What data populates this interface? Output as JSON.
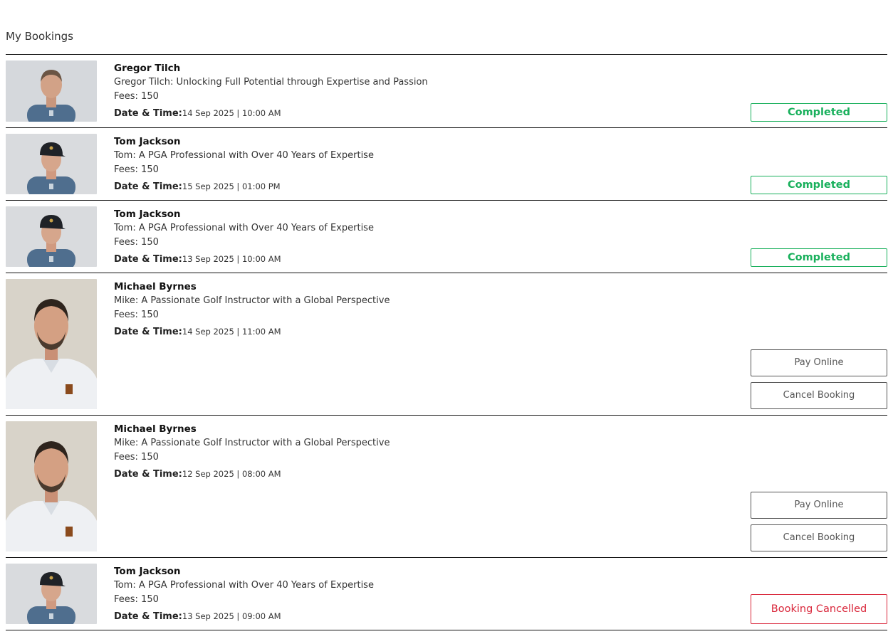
{
  "page": {
    "title": "My Bookings"
  },
  "labels": {
    "fees_prefix": "Fees: ",
    "datetime_label": "Date & Time:"
  },
  "colors": {
    "completed": "#19b05c",
    "cancelled": "#d9263a",
    "divider": "#111111"
  },
  "bookings": [
    {
      "coach": "Gregor Tilch",
      "headline": "Gregor Tilch: Unlocking Full Potential through Expertise and Passion",
      "fees": "Fees: 150",
      "datetime_label": "Date & Time:",
      "datetime": "14 Sep 2025 | 10:00 AM",
      "status": "Completed",
      "photo": "coach-photo-gregor"
    },
    {
      "coach": "Tom Jackson",
      "headline": "Tom: A PGA Professional with Over 40 Years of Expertise",
      "fees": "Fees: 150",
      "datetime_label": "Date & Time:",
      "datetime": "15 Sep 2025 | 01:00 PM",
      "status": "Completed",
      "photo": "coach-photo-tom"
    },
    {
      "coach": "Tom Jackson",
      "headline": "Tom: A PGA Professional with Over 40 Years of Expertise",
      "fees": "Fees: 150",
      "datetime_label": "Date & Time:",
      "datetime": "13 Sep 2025 | 10:00 AM",
      "status": "Completed",
      "photo": "coach-photo-tom"
    },
    {
      "coach": "Michael Byrnes",
      "headline": "Mike: A Passionate Golf Instructor with a Global Perspective",
      "fees": "Fees: 150",
      "datetime_label": "Date & Time:",
      "datetime": "14 Sep 2025 | 11:00 AM",
      "pay_label": "Pay Online",
      "cancel_label": "Cancel Booking",
      "photo": "coach-photo-michael"
    },
    {
      "coach": "Michael Byrnes",
      "headline": "Mike: A Passionate Golf Instructor with a Global Perspective",
      "fees": "Fees: 150",
      "datetime_label": "Date & Time:",
      "datetime": "12 Sep 2025 | 08:00 AM",
      "pay_label": "Pay Online",
      "cancel_label": "Cancel Booking",
      "photo": "coach-photo-michael"
    },
    {
      "coach": "Tom Jackson",
      "headline": "Tom: A PGA Professional with Over 40 Years of Expertise",
      "fees": "Fees: 150",
      "datetime_label": "Date & Time:",
      "datetime": "13 Sep 2025 | 09:00 AM",
      "status": "Booking Cancelled",
      "photo": "coach-photo-tom"
    }
  ]
}
